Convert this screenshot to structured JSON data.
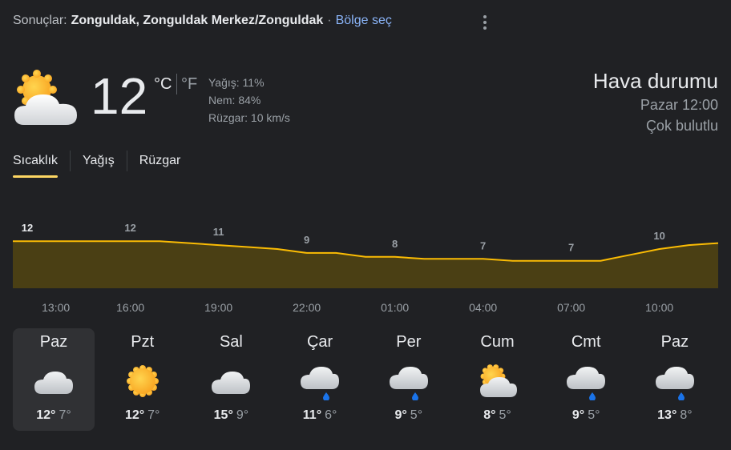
{
  "header": {
    "prefix": "Sonuçlar:",
    "location": "Zonguldak, Zonguldak Merkez/Zonguldak",
    "separator": "·",
    "region_link": "Bölge seç"
  },
  "current": {
    "icon": "partly-cloudy-icon",
    "temp": "12",
    "unit_c": "°C",
    "unit_f": "°F",
    "precip": "Yağış: 11%",
    "humidity": "Nem: 84%",
    "wind": "Rüzgar: 10 km/s"
  },
  "summary": {
    "title": "Hava durumu",
    "time": "Pazar 12:00",
    "condition": "Çok bulutlu"
  },
  "tabs": [
    "Sıcaklık",
    "Yağış",
    "Rüzgar"
  ],
  "chart_data": {
    "type": "area",
    "x": [
      "12:00",
      "13:00",
      "14:00",
      "15:00",
      "16:00",
      "17:00",
      "18:00",
      "19:00",
      "20:00",
      "21:00",
      "22:00",
      "23:00",
      "00:00",
      "01:00",
      "02:00",
      "03:00",
      "04:00",
      "05:00",
      "06:00",
      "07:00",
      "08:00",
      "09:00",
      "10:00",
      "11:00",
      "12:00"
    ],
    "values": [
      12,
      12,
      12,
      12,
      12,
      12,
      11.5,
      11,
      10.5,
      10,
      9,
      9,
      8,
      8,
      7.5,
      7.5,
      7.5,
      7,
      7,
      7,
      7,
      8.5,
      10,
      11,
      11.5
    ],
    "labels": [
      "12",
      "12",
      "11",
      "9",
      "8",
      "7",
      "7",
      "10"
    ],
    "time_labels": [
      "13:00",
      "16:00",
      "19:00",
      "22:00",
      "01:00",
      "04:00",
      "07:00",
      "10:00"
    ],
    "ylim": [
      0,
      15
    ],
    "line_color": "#fbbc04",
    "fill_color": "#4a3f14",
    "grid": false
  },
  "days": [
    {
      "name": "Paz",
      "icon": "cloudy-icon",
      "hi": "12°",
      "lo": "7°"
    },
    {
      "name": "Pzt",
      "icon": "sunny-icon",
      "hi": "12°",
      "lo": "7°"
    },
    {
      "name": "Sal",
      "icon": "cloudy-icon",
      "hi": "15°",
      "lo": "9°"
    },
    {
      "name": "Çar",
      "icon": "rain-icon",
      "hi": "11°",
      "lo": "6°"
    },
    {
      "name": "Per",
      "icon": "rain-icon",
      "hi": "9°",
      "lo": "5°"
    },
    {
      "name": "Cum",
      "icon": "partly-cloudy-icon",
      "hi": "8°",
      "lo": "5°"
    },
    {
      "name": "Cmt",
      "icon": "rain-icon",
      "hi": "9°",
      "lo": "5°"
    },
    {
      "name": "Paz",
      "icon": "rain-icon",
      "hi": "13°",
      "lo": "8°"
    }
  ]
}
